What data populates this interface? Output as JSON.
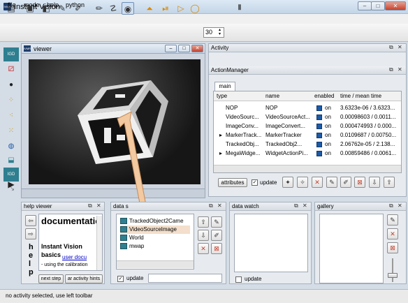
{
  "app": {
    "title": "Instant Vision",
    "icon_text": "IVMR"
  },
  "window_buttons": {
    "minimize": "–",
    "maximize": "□",
    "close": "✕"
  },
  "menu": [
    "file",
    "mode",
    "help",
    "python"
  ],
  "toolbar": {
    "frame_value": "30"
  },
  "viewer": {
    "title": "viewer"
  },
  "activity": {
    "title": "Activity"
  },
  "action_manager": {
    "title": "ActionManager",
    "tab": "main",
    "columns": [
      "type",
      "name",
      "enabled",
      "time / mean time"
    ],
    "rows": [
      {
        "expand": "",
        "type": "NOP",
        "name": "NOP",
        "enabled": "on",
        "time": "3.6323e-06 / 3.6323..."
      },
      {
        "expand": "",
        "type": "VideoSourc...",
        "name": "VideoSourceAct...",
        "enabled": "on",
        "time": "0.00098603 / 0.0011..."
      },
      {
        "expand": "",
        "type": "ImageConv...",
        "name": "ImageConvert...",
        "enabled": "on",
        "time": "0.000474993 / 0.000..."
      },
      {
        "expand": "▸",
        "type": "MarkerTrack...",
        "name": "MarkerTracker",
        "enabled": "on",
        "time": "0.0109687 / 0.00750..."
      },
      {
        "expand": "",
        "type": "TrackedObj...",
        "name": "TrackedObj2...",
        "enabled": "on",
        "time": "2.06762e-05 / 2.138..."
      },
      {
        "expand": "▸",
        "type": "MegaWidge...",
        "name": "WidgetActionPi...",
        "enabled": "on",
        "time": "0.00859486 / 0.0061..."
      }
    ],
    "attributes_button": "attributes",
    "update_label": "update"
  },
  "help_viewer": {
    "title": "help viewer",
    "heading": "documentation",
    "subheading": "Instant Vision basics",
    "link": "user docu",
    "body": "- using the calibration",
    "side_letters": [
      "h",
      "e",
      "l",
      "p"
    ],
    "next_step": "next step",
    "activity_hints": "ar activity hints"
  },
  "data_panel": {
    "title": "data s",
    "items": [
      "TrackedObject2Came",
      "VideoSourceImage",
      "World",
      "mwap"
    ],
    "update_label": "update"
  },
  "data_watch": {
    "title": "data watch",
    "update_label": "update"
  },
  "gallery": {
    "title": "gallery"
  },
  "status": "no activity selected, use left toolbar",
  "colors": {
    "accent": "#1c5aa6",
    "arrow": "#f2c9a0",
    "close_red": "#c4422e"
  }
}
